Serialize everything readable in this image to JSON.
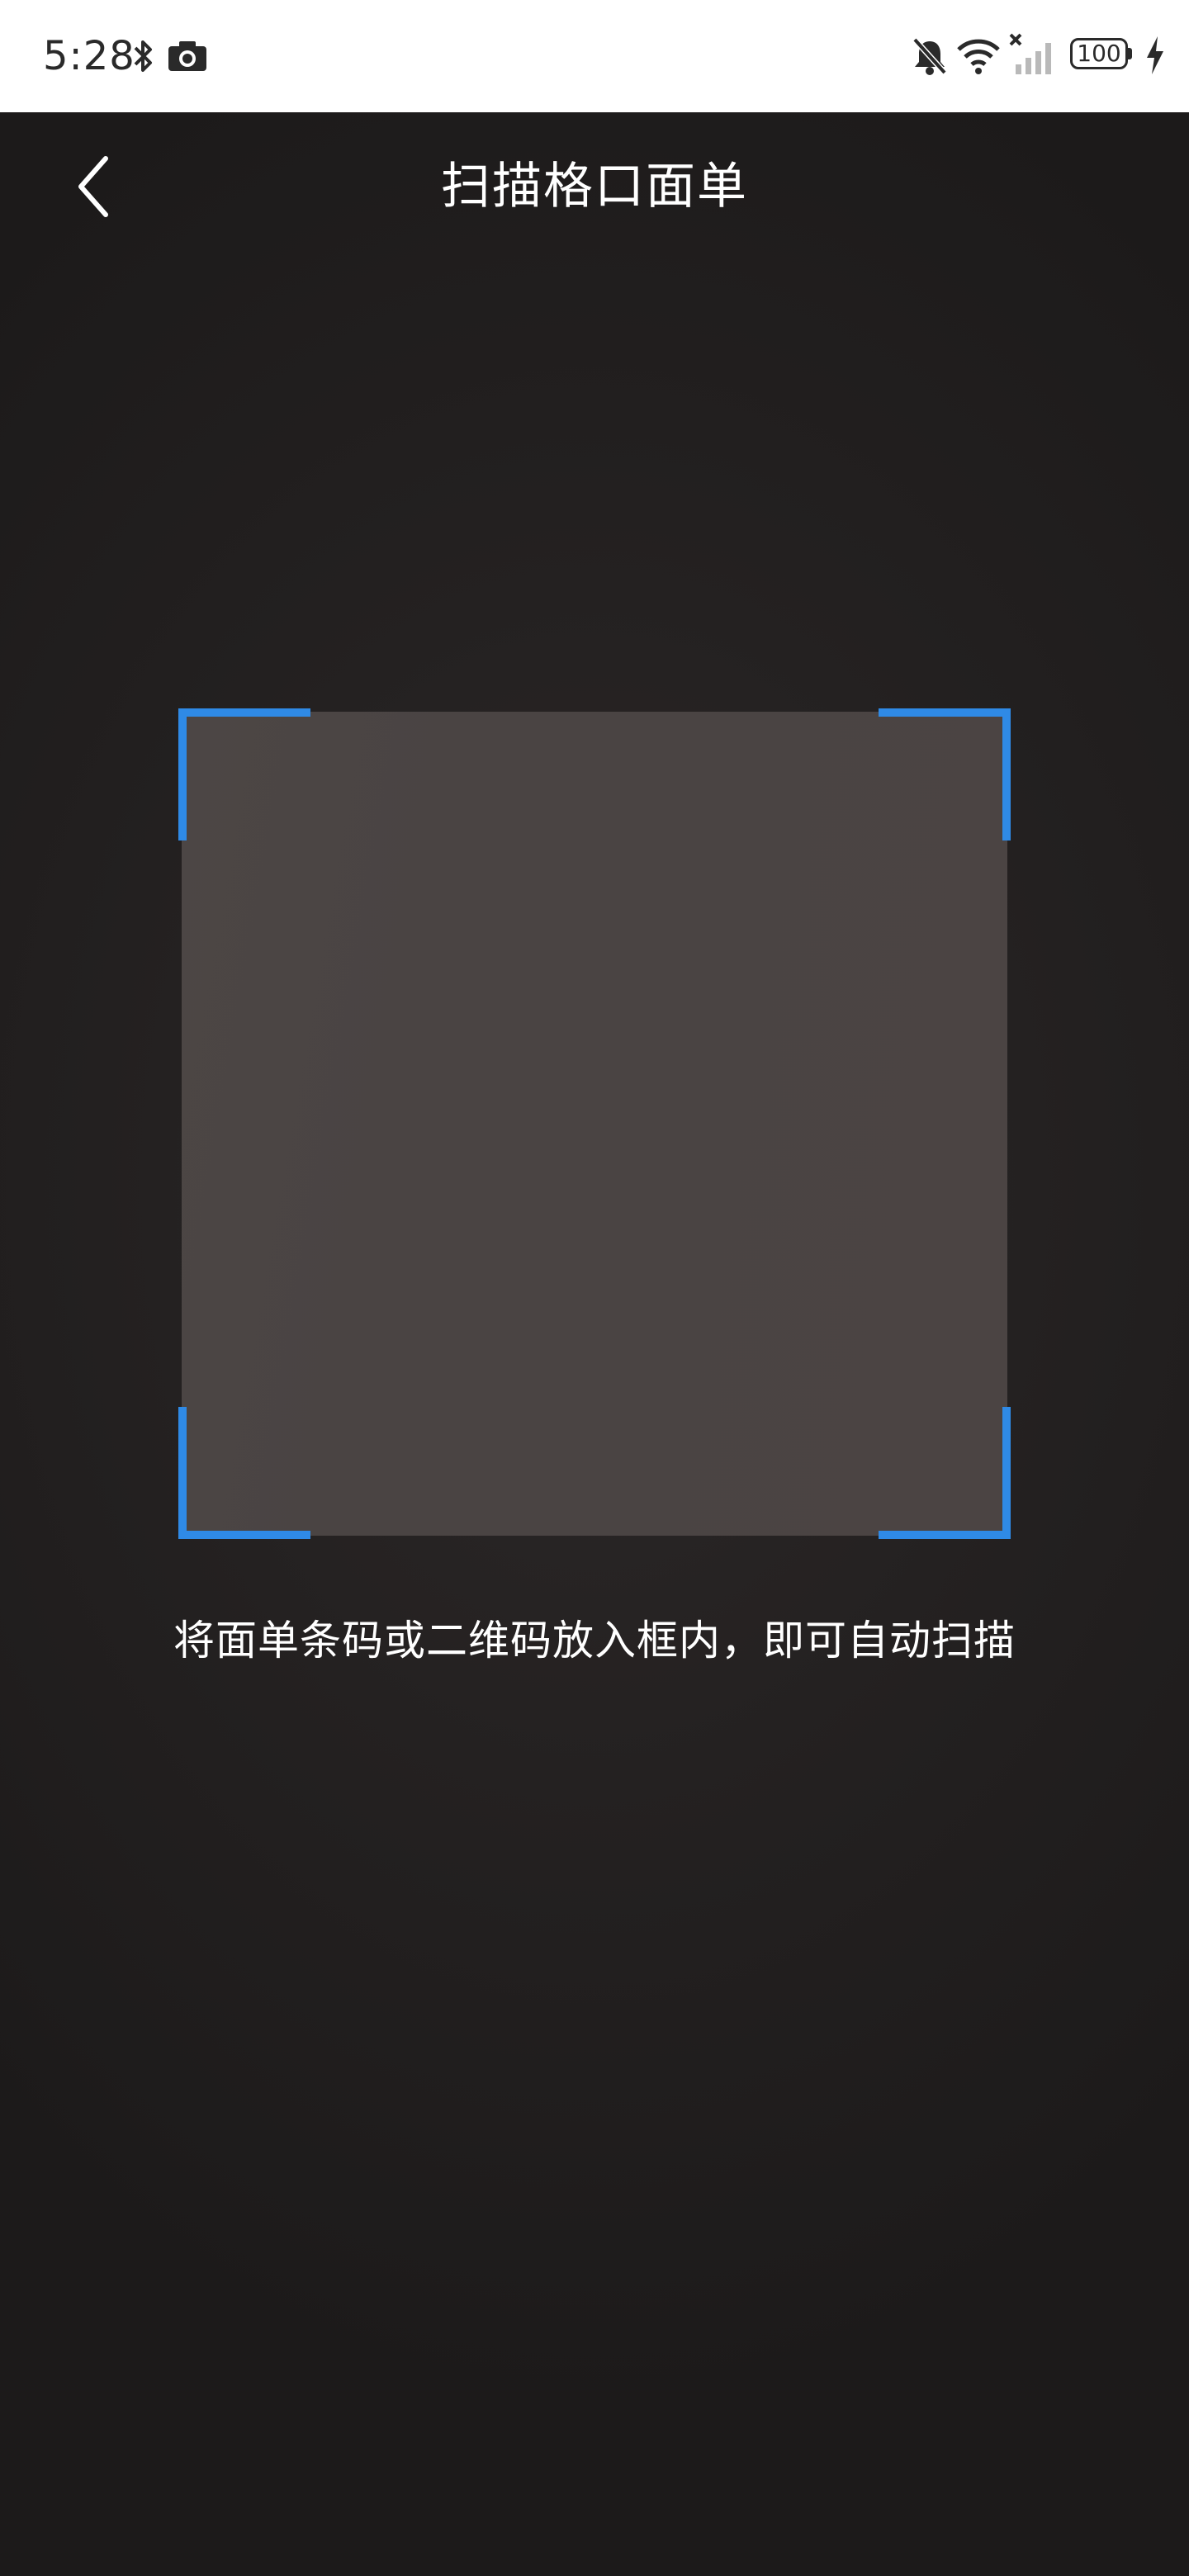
{
  "status_bar": {
    "time": "5:28",
    "battery_level": "100",
    "icons_left": [
      "bluetooth-icon",
      "camera-icon"
    ],
    "icons_right": [
      "notifications-off-icon",
      "wifi-icon",
      "cellular-no-signal-icon",
      "battery-icon",
      "charging-icon"
    ]
  },
  "header": {
    "title": "扫描格口面单",
    "back_icon": "chevron-left-icon"
  },
  "scanner": {
    "hint": "将面单条码或二维码放入框内，即可自动扫描",
    "corner_color": "#2f8ae6"
  },
  "colors": {
    "status_bar_bg": "#ffffff",
    "camera_bg": "#1f1d1d",
    "scan_area": "#4b4544",
    "accent": "#2f8ae6"
  }
}
